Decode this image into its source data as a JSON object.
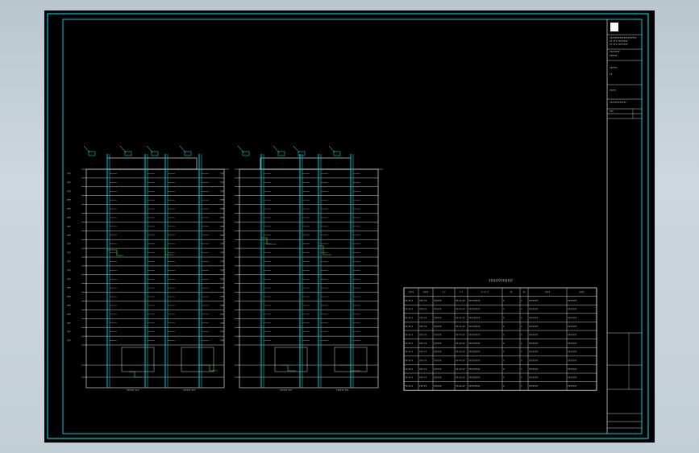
{
  "drawing": {
    "sheet_frame_color": "#00c8d8",
    "table_title": "??????????????"
  },
  "title_block": {
    "lines": [
      "?????????????????????",
      "?? ??? ????????",
      "?? ??? ????????",
      "????????",
      "??????",
      "??????",
      "??",
      "?????",
      "?????????????",
      "???"
    ]
  },
  "table": {
    "headers": [
      "????",
      "????",
      "? ?",
      "? ?",
      "? ? ? ?",
      "??",
      "??",
      "????",
      "????"
    ],
    "rows": [
      [
        "??-??-?",
        "???-??",
        "??????",
        "??-??-??",
        "?????????",
        "?",
        "?",
        "???????",
        "???????"
      ],
      [
        "??-??-?",
        "???-??",
        "??????",
        "??-??-??",
        "?????????",
        "?",
        "?",
        "???????",
        "???????"
      ],
      [
        "??-??-?",
        "???-??",
        "??????",
        "??-??-??",
        "?????????",
        "?",
        "?",
        "???????",
        "???????"
      ],
      [
        "??-??-?",
        "???-??",
        "??????",
        "??-??-??",
        "?????????",
        "?",
        "?",
        "???????",
        "???????"
      ],
      [
        "??-??-?",
        "???-??",
        "??????",
        "??-??-??",
        "?????????",
        "?",
        "?",
        "???????",
        "???????"
      ],
      [
        "??-??-?",
        "???-??",
        "??????",
        "??-??-??",
        "?????????",
        "?",
        "?",
        "???????",
        "???????"
      ],
      [
        "??-??-?",
        "???-??",
        "??????",
        "??-??-??",
        "?????????",
        "?",
        "?",
        "???????",
        "???????"
      ],
      [
        "??-??-?",
        "???-??",
        "??????",
        "??-??-??",
        "?????????",
        "?",
        "?",
        "???????",
        "???????"
      ],
      [
        "??-??-?",
        "???-??",
        "??????",
        "??-??-??",
        "?????????",
        "?",
        "?",
        "???????",
        "???????"
      ],
      [
        "??-??-?",
        "???-??",
        "??????",
        "??-??-??",
        "?????????",
        "?",
        "?",
        "???????",
        "???????"
      ],
      [
        "??-??-?",
        "???-??",
        "??????",
        "??-??-??",
        "?????????",
        "?",
        "?",
        "???????",
        "???????"
      ]
    ]
  },
  "left_building": {
    "floor_labels": [
      "???",
      "???",
      "???",
      "???",
      "???",
      "???",
      "???",
      "???",
      "???",
      "???",
      "???",
      "???",
      "???",
      "???",
      "???",
      "???",
      "???",
      "???",
      "???",
      "???"
    ],
    "base_labels": [
      "?????? ???",
      "?????? ???"
    ]
  },
  "right_building": {
    "floor_labels": [
      "???",
      "???",
      "???",
      "???",
      "???",
      "???",
      "???",
      "???",
      "???",
      "???",
      "???",
      "???",
      "???",
      "???",
      "???",
      "???",
      "???",
      "???",
      "???",
      "???"
    ],
    "base_labels": [
      "?????? ???",
      "?????? ???"
    ]
  }
}
